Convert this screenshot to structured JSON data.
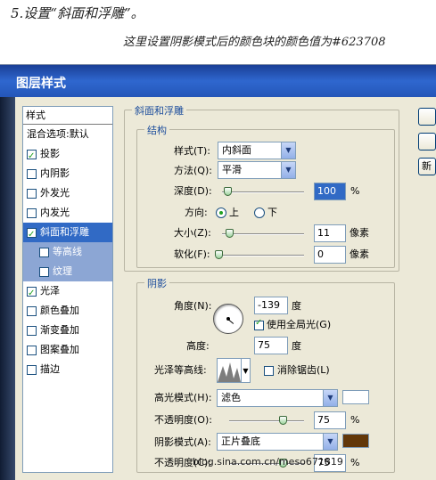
{
  "tutorial": {
    "step_text": "5.设置“斜面和浮雕”。",
    "note_text": "这里设置阴影模式后的颜色块的颜色值为#623708"
  },
  "dialog": {
    "title": "图层样式",
    "style_list": {
      "header": "样式",
      "blend_options": "混合选项:默认",
      "items": [
        {
          "label": "投影",
          "checked": true
        },
        {
          "label": "内阴影",
          "checked": false
        },
        {
          "label": "外发光",
          "checked": false
        },
        {
          "label": "内发光",
          "checked": false
        },
        {
          "label": "斜面和浮雕",
          "checked": true,
          "selected": true
        },
        {
          "label": "等高线",
          "checked": false,
          "sub": true
        },
        {
          "label": "纹理",
          "checked": false,
          "sub": true
        },
        {
          "label": "光泽",
          "checked": true
        },
        {
          "label": "颜色叠加",
          "checked": false
        },
        {
          "label": "渐变叠加",
          "checked": false
        },
        {
          "label": "图案叠加",
          "checked": false
        },
        {
          "label": "描边",
          "checked": false
        }
      ]
    },
    "bevel": {
      "group_title": "斜面和浮雕",
      "structure_title": "结构",
      "style_label": "样式(T):",
      "style_value": "内斜面",
      "technique_label": "方法(Q):",
      "technique_value": "平滑",
      "depth_label": "深度(D):",
      "depth_value": "100",
      "depth_unit": "%",
      "depth_fraction": 0.03,
      "direction_label": "方向:",
      "direction_up": "上",
      "direction_down": "下",
      "direction_selected": "上",
      "size_label": "大小(Z):",
      "size_value": "11",
      "size_unit": "像素",
      "size_fraction": 0.05,
      "soften_label": "软化(F):",
      "soften_value": "0",
      "soften_unit": "像素",
      "soften_fraction": 0.0
    },
    "shading": {
      "group_title": "阴影",
      "angle_label": "角度(N):",
      "angle_value": "-139",
      "angle_unit": "度",
      "global_light_label": "使用全局光(G)",
      "global_light_checked": true,
      "altitude_label": "高度:",
      "altitude_value": "75",
      "altitude_unit": "度",
      "gloss_contour_label": "光泽等高线:",
      "anti_aliased_label": "消除锯齿(L)",
      "anti_aliased_checked": false,
      "highlight_mode_label": "高光模式(H):",
      "highlight_mode_value": "滤色",
      "highlight_color": "#ffffff",
      "highlight_opacity_label": "不透明度(O):",
      "highlight_opacity_value": "75",
      "highlight_opacity_fraction": 0.75,
      "opacity_unit": "%",
      "shadow_mode_label": "阴影模式(A):",
      "shadow_mode_value": "正片叠底",
      "shadow_color": "#623708",
      "shadow_opacity_label": "不透明度(C):",
      "shadow_opacity_value": "75",
      "shadow_opacity_fraction": 0.75
    },
    "buttons": {
      "new_label": "新"
    }
  },
  "watermark": "blog.sina.com.cn/meso671819"
}
